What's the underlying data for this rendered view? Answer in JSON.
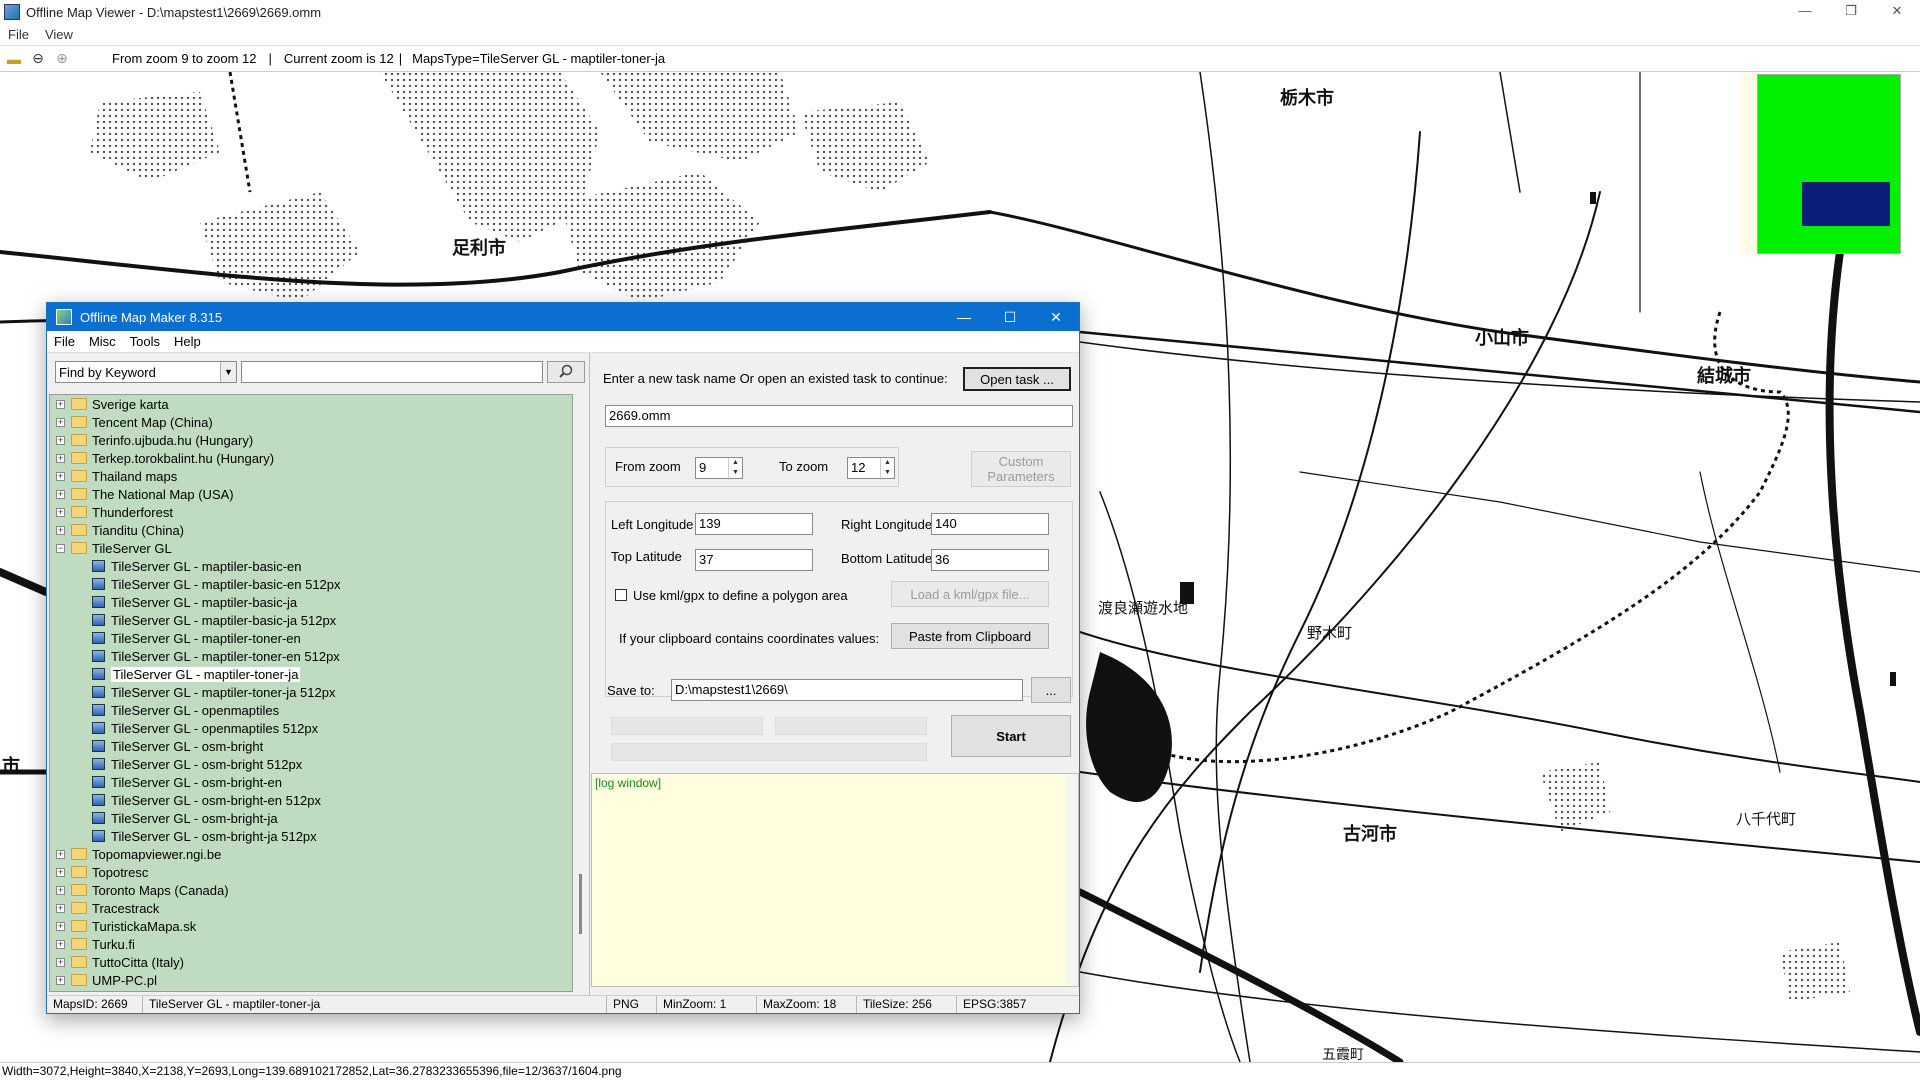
{
  "viewer": {
    "title": "Offline Map Viewer - D:\\mapstest1\\2669\\2669.omm",
    "menu": [
      "File",
      "View"
    ],
    "toolbar": {
      "zoom_range": "From zoom 9 to zoom 12",
      "current_zoom": "Current zoom is 12",
      "maps_type": "MapsType=TileServer GL - maptiler-toner-ja"
    },
    "status": "Width=3072,Height=3840,X=2138,Y=2693,Long=139.689102172852,Lat=36.2783233655396,file=12/3637/1604.png"
  },
  "map_labels": [
    {
      "text": "栃木市",
      "size": "big"
    },
    {
      "text": "足利市",
      "size": "big"
    },
    {
      "text": "小山市",
      "size": "big"
    },
    {
      "text": "結城市",
      "size": "big"
    },
    {
      "text": "渡良瀬遊水地",
      "size": "small"
    },
    {
      "text": "野木町",
      "size": "small"
    },
    {
      "text": "古河市",
      "size": "big"
    },
    {
      "text": "八千代町",
      "size": "small"
    },
    {
      "text": "市",
      "size": "big"
    },
    {
      "text": "五霞町",
      "size": "small"
    }
  ],
  "dialog": {
    "title": "Offline Map Maker 8.315",
    "menu": [
      "File",
      "Misc",
      "Tools",
      "Help"
    ],
    "search": {
      "mode": "Find by Keyword",
      "value": ""
    },
    "tree": [
      {
        "label": "Sverige karta",
        "type": "folder",
        "expanded": false
      },
      {
        "label": "Tencent Map (China)",
        "type": "folder",
        "expanded": false
      },
      {
        "label": "Terinfo.ujbuda.hu (Hungary)",
        "type": "folder",
        "expanded": false
      },
      {
        "label": "Terkep.torokbalint.hu (Hungary)",
        "type": "folder",
        "expanded": false
      },
      {
        "label": "Thailand maps",
        "type": "folder",
        "expanded": false
      },
      {
        "label": "The National Map (USA)",
        "type": "folder",
        "expanded": false
      },
      {
        "label": "Thunderforest",
        "type": "folder",
        "expanded": false
      },
      {
        "label": "Tianditu (China)",
        "type": "folder",
        "expanded": false
      },
      {
        "label": "TileServer GL",
        "type": "folder",
        "expanded": true
      },
      {
        "label": "TileServer GL - maptiler-basic-en",
        "type": "map"
      },
      {
        "label": "TileServer GL - maptiler-basic-en 512px",
        "type": "map"
      },
      {
        "label": "TileServer GL - maptiler-basic-ja",
        "type": "map"
      },
      {
        "label": "TileServer GL - maptiler-basic-ja 512px",
        "type": "map"
      },
      {
        "label": "TileServer GL - maptiler-toner-en",
        "type": "map"
      },
      {
        "label": "TileServer GL - maptiler-toner-en 512px",
        "type": "map"
      },
      {
        "label": "TileServer GL - maptiler-toner-ja",
        "type": "map",
        "selected": true
      },
      {
        "label": "TileServer GL - maptiler-toner-ja 512px",
        "type": "map"
      },
      {
        "label": "TileServer GL - openmaptiles",
        "type": "map"
      },
      {
        "label": "TileServer GL - openmaptiles 512px",
        "type": "map"
      },
      {
        "label": "TileServer GL - osm-bright",
        "type": "map"
      },
      {
        "label": "TileServer GL - osm-bright 512px",
        "type": "map"
      },
      {
        "label": "TileServer GL - osm-bright-en",
        "type": "map"
      },
      {
        "label": "TileServer GL - osm-bright-en 512px",
        "type": "map"
      },
      {
        "label": "TileServer GL - osm-bright-ja",
        "type": "map"
      },
      {
        "label": "TileServer GL - osm-bright-ja 512px",
        "type": "map"
      },
      {
        "label": "Topomapviewer.ngi.be",
        "type": "folder",
        "expanded": false
      },
      {
        "label": "Topotresc",
        "type": "folder",
        "expanded": false
      },
      {
        "label": "Toronto Maps (Canada)",
        "type": "folder",
        "expanded": false
      },
      {
        "label": "Tracestrack",
        "type": "folder",
        "expanded": false
      },
      {
        "label": "TuristickaMapa.sk",
        "type": "folder",
        "expanded": false
      },
      {
        "label": "Turku.fi",
        "type": "folder",
        "expanded": false
      },
      {
        "label": "TuttoCitta (Italy)",
        "type": "folder",
        "expanded": false
      },
      {
        "label": "UMP-PC.pl",
        "type": "folder",
        "expanded": false
      }
    ],
    "task": {
      "prompt": "Enter a new task name Or open an existed task to continue:",
      "open_btn": "Open task ...",
      "name": "2669.omm"
    },
    "zoom": {
      "from_label": "From zoom",
      "from_value": "9",
      "to_label": "To zoom",
      "to_value": "12",
      "custom_btn": "Custom Parameters"
    },
    "coords": {
      "left_label": "Left Longitude",
      "left": "139",
      "right_label": "Right Longitude",
      "right": "140",
      "top_label": "Top Latitude",
      "top": "37",
      "bottom_label": "Bottom Latitude",
      "bottom": "36"
    },
    "kml": {
      "label": "Use kml/gpx to define a polygon area",
      "btn": "Load a kml/gpx file..."
    },
    "clipboard": {
      "label": "If your clipboard contains coordinates values:",
      "btn": "Paste from Clipboard"
    },
    "save": {
      "label": "Save to:",
      "path": "D:\\mapstest1\\2669\\",
      "browse": "..."
    },
    "start_btn": "Start",
    "log": "[log window]",
    "status": {
      "maps_id": "MapsID: 2669",
      "map_name": "TileServer GL - maptiler-toner-ja",
      "format": "PNG",
      "min_zoom": "MinZoom: 1",
      "max_zoom": "MaxZoom: 18",
      "tile_size": "TileSize: 256",
      "epsg": "EPSG:3857"
    }
  }
}
